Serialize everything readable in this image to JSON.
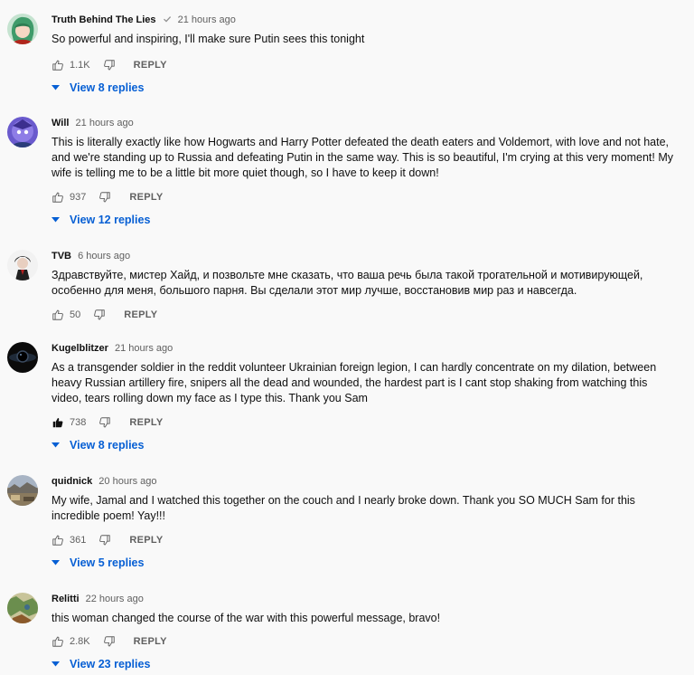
{
  "comments": [
    {
      "author": "Truth Behind The Lies",
      "verified": true,
      "time": "21 hours ago",
      "text": "So powerful and inspiring, I'll make sure Putin sees this tonight",
      "likes": "1.1K",
      "liked": false,
      "reply_label": "REPLY",
      "view_replies": "View 8 replies",
      "avatar": "green-haired-character-avatar"
    },
    {
      "author": "Will",
      "verified": false,
      "time": "21 hours ago",
      "text": "This is literally exactly like how Hogwarts and Harry Potter defeated the death eaters and Voldemort, with love and not hate, and we're standing up to Russia and defeating Putin in the same way. This is so beautiful, I'm crying at this very moment! My wife is telling me to be a little bit more quiet though, so I have to keep it down!",
      "likes": "937",
      "liked": false,
      "reply_label": "REPLY",
      "view_replies": "View 12 replies",
      "avatar": "purple-character-avatar"
    },
    {
      "author": "TVB",
      "verified": false,
      "time": "6 hours ago",
      "text": "Здравствуйте, мистер Хайд, и позвольте мне сказать, что ваша речь была такой трогательной и мотивирующей, особенно для меня, большого парня.  Вы сделали этот мир лучше, восстановив мир раз и навсегда.",
      "likes": "50",
      "liked": false,
      "reply_label": "REPLY",
      "view_replies": "",
      "avatar": "dark-haired-figure-avatar"
    },
    {
      "author": "Kugelblitzer",
      "verified": false,
      "time": "21 hours ago",
      "text": "As a transgender soldier in the reddit volunteer Ukrainian foreign legion, I can hardly concentrate on my dilation, between heavy Russian artillery fire, snipers all the dead and wounded, the hardest part is I cant stop shaking from watching this video, tears rolling down my face as I type this. Thank you Sam",
      "likes": "738",
      "liked": true,
      "reply_label": "REPLY",
      "view_replies": "View 8 replies",
      "avatar": "black-hole-avatar"
    },
    {
      "author": "quidnick",
      "verified": false,
      "time": "20 hours ago",
      "text": "My wife, Jamal and I watched this together on the couch and I nearly broke down. Thank you SO MUCH Sam for this incredible poem! Yay!!!",
      "likes": "361",
      "liked": false,
      "reply_label": "REPLY",
      "view_replies": "View 5 replies",
      "avatar": "landscape-photo-avatar"
    },
    {
      "author": "Relitti",
      "verified": false,
      "time": "22 hours ago",
      "text": "this woman changed the course of the war with this powerful message, bravo!",
      "likes": "2.8K",
      "liked": false,
      "reply_label": "REPLY",
      "view_replies": "View 23 replies",
      "avatar": "map-avatar"
    }
  ],
  "colors": {
    "background": "#f9f9f9",
    "text": "#0f0f0f",
    "secondary": "#606060",
    "link": "#065fd4"
  }
}
